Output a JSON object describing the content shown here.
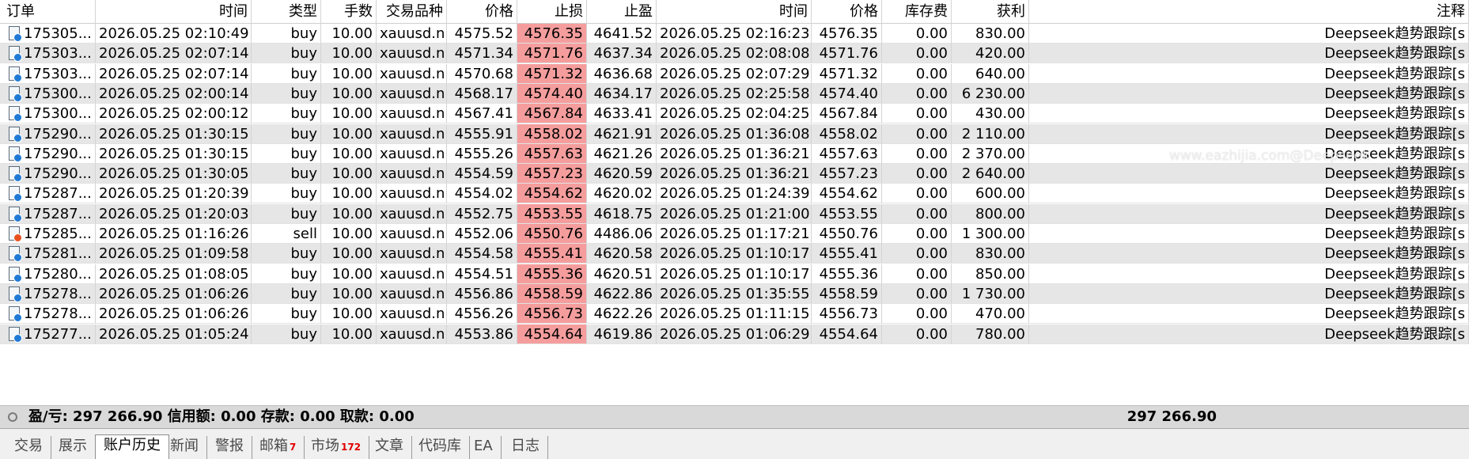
{
  "headers": [
    "订单",
    "时间",
    "类型",
    "手数",
    "交易品种",
    "价格",
    "止损",
    "止盈",
    "时间",
    "价格",
    "库存费",
    "获利",
    "注释"
  ],
  "rows": [
    {
      "order": "175305...",
      "open_time": "2026.05.25 02:10:49",
      "type": "buy",
      "lots": "10.00",
      "symbol": "xauusd.n",
      "open_price": "4575.52",
      "sl": "4576.35",
      "tp": "4641.52",
      "close_time": "2026.05.25 02:16:23",
      "close_price": "4576.35",
      "swap": "0.00",
      "profit": "830.00",
      "comment": "Deepseek趋势跟踪[s"
    },
    {
      "order": "175303...",
      "open_time": "2026.05.25 02:07:14",
      "type": "buy",
      "lots": "10.00",
      "symbol": "xauusd.n",
      "open_price": "4571.34",
      "sl": "4571.76",
      "tp": "4637.34",
      "close_time": "2026.05.25 02:08:08",
      "close_price": "4571.76",
      "swap": "0.00",
      "profit": "420.00",
      "comment": "Deepseek趋势跟踪[s"
    },
    {
      "order": "175303...",
      "open_time": "2026.05.25 02:07:14",
      "type": "buy",
      "lots": "10.00",
      "symbol": "xauusd.n",
      "open_price": "4570.68",
      "sl": "4571.32",
      "tp": "4636.68",
      "close_time": "2026.05.25 02:07:29",
      "close_price": "4571.32",
      "swap": "0.00",
      "profit": "640.00",
      "comment": "Deepseek趋势跟踪[s"
    },
    {
      "order": "175300...",
      "open_time": "2026.05.25 02:00:14",
      "type": "buy",
      "lots": "10.00",
      "symbol": "xauusd.n",
      "open_price": "4568.17",
      "sl": "4574.40",
      "tp": "4634.17",
      "close_time": "2026.05.25 02:25:58",
      "close_price": "4574.40",
      "swap": "0.00",
      "profit": "6 230.00",
      "comment": "Deepseek趋势跟踪[s"
    },
    {
      "order": "175300...",
      "open_time": "2026.05.25 02:00:12",
      "type": "buy",
      "lots": "10.00",
      "symbol": "xauusd.n",
      "open_price": "4567.41",
      "sl": "4567.84",
      "tp": "4633.41",
      "close_time": "2026.05.25 02:04:25",
      "close_price": "4567.84",
      "swap": "0.00",
      "profit": "430.00",
      "comment": "Deepseek趋势跟踪[s"
    },
    {
      "order": "175290...",
      "open_time": "2026.05.25 01:30:15",
      "type": "buy",
      "lots": "10.00",
      "symbol": "xauusd.n",
      "open_price": "4555.91",
      "sl": "4558.02",
      "tp": "4621.91",
      "close_time": "2026.05.25 01:36:08",
      "close_price": "4558.02",
      "swap": "0.00",
      "profit": "2 110.00",
      "comment": "Deepseek趋势跟踪[s"
    },
    {
      "order": "175290...",
      "open_time": "2026.05.25 01:30:15",
      "type": "buy",
      "lots": "10.00",
      "symbol": "xauusd.n",
      "open_price": "4555.26",
      "sl": "4557.63",
      "tp": "4621.26",
      "close_time": "2026.05.25 01:36:21",
      "close_price": "4557.63",
      "swap": "0.00",
      "profit": "2 370.00",
      "comment": "Deepseek趋势跟踪[s"
    },
    {
      "order": "175290...",
      "open_time": "2026.05.25 01:30:05",
      "type": "buy",
      "lots": "10.00",
      "symbol": "xauusd.n",
      "open_price": "4554.59",
      "sl": "4557.23",
      "tp": "4620.59",
      "close_time": "2026.05.25 01:36:21",
      "close_price": "4557.23",
      "swap": "0.00",
      "profit": "2 640.00",
      "comment": "Deepseek趋势跟踪[s"
    },
    {
      "order": "175287...",
      "open_time": "2026.05.25 01:20:39",
      "type": "buy",
      "lots": "10.00",
      "symbol": "xauusd.n",
      "open_price": "4554.02",
      "sl": "4554.62",
      "tp": "4620.02",
      "close_time": "2026.05.25 01:24:39",
      "close_price": "4554.62",
      "swap": "0.00",
      "profit": "600.00",
      "comment": "Deepseek趋势跟踪[s"
    },
    {
      "order": "175287...",
      "open_time": "2026.05.25 01:20:03",
      "type": "buy",
      "lots": "10.00",
      "symbol": "xauusd.n",
      "open_price": "4552.75",
      "sl": "4553.55",
      "tp": "4618.75",
      "close_time": "2026.05.25 01:21:00",
      "close_price": "4553.55",
      "swap": "0.00",
      "profit": "800.00",
      "comment": "Deepseek趋势跟踪[s"
    },
    {
      "order": "175285...",
      "open_time": "2026.05.25 01:16:26",
      "type": "sell",
      "lots": "10.00",
      "symbol": "xauusd.n",
      "open_price": "4552.06",
      "sl": "4550.76",
      "tp": "4486.06",
      "close_time": "2026.05.25 01:17:21",
      "close_price": "4550.76",
      "swap": "0.00",
      "profit": "1 300.00",
      "comment": "Deepseek趋势跟踪[s"
    },
    {
      "order": "175281...",
      "open_time": "2026.05.25 01:09:58",
      "type": "buy",
      "lots": "10.00",
      "symbol": "xauusd.n",
      "open_price": "4554.58",
      "sl": "4555.41",
      "tp": "4620.58",
      "close_time": "2026.05.25 01:10:17",
      "close_price": "4555.41",
      "swap": "0.00",
      "profit": "830.00",
      "comment": "Deepseek趋势跟踪[s"
    },
    {
      "order": "175280...",
      "open_time": "2026.05.25 01:08:05",
      "type": "buy",
      "lots": "10.00",
      "symbol": "xauusd.n",
      "open_price": "4554.51",
      "sl": "4555.36",
      "tp": "4620.51",
      "close_time": "2026.05.25 01:10:17",
      "close_price": "4555.36",
      "swap": "0.00",
      "profit": "850.00",
      "comment": "Deepseek趋势跟踪[s"
    },
    {
      "order": "175278...",
      "open_time": "2026.05.25 01:06:26",
      "type": "buy",
      "lots": "10.00",
      "symbol": "xauusd.n",
      "open_price": "4556.86",
      "sl": "4558.59",
      "tp": "4622.86",
      "close_time": "2026.05.25 01:35:55",
      "close_price": "4558.59",
      "swap": "0.00",
      "profit": "1 730.00",
      "comment": "Deepseek趋势跟踪[s"
    },
    {
      "order": "175278...",
      "open_time": "2026.05.25 01:06:26",
      "type": "buy",
      "lots": "10.00",
      "symbol": "xauusd.n",
      "open_price": "4556.26",
      "sl": "4556.73",
      "tp": "4622.26",
      "close_time": "2026.05.25 01:11:15",
      "close_price": "4556.73",
      "swap": "0.00",
      "profit": "470.00",
      "comment": "Deepseek趋势跟踪[s"
    },
    {
      "order": "175277...",
      "open_time": "2026.05.25 01:05:24",
      "type": "buy",
      "lots": "10.00",
      "symbol": "xauusd.n",
      "open_price": "4553.86",
      "sl": "4554.64",
      "tp": "4619.86",
      "close_time": "2026.05.25 01:06:29",
      "close_price": "4554.64",
      "swap": "0.00",
      "profit": "780.00",
      "comment": "Deepseek趋势跟踪[s"
    }
  ],
  "summary": {
    "text": "盈/亏: 297 266.90  信用额: 0.00  存款: 0.00  取款: 0.00",
    "total": "297 266.90"
  },
  "tabs": [
    {
      "label": "交易"
    },
    {
      "label": "展示"
    },
    {
      "label": "账户历史",
      "active": true
    },
    {
      "label": "新闻"
    },
    {
      "label": "警报"
    },
    {
      "label": "邮箱",
      "badge": "7"
    },
    {
      "label": "市场",
      "badge": "172"
    },
    {
      "label": "文章"
    },
    {
      "label": "代码库"
    },
    {
      "label": "EA"
    },
    {
      "label": "日志"
    }
  ],
  "watermark": "www.eazhijia.com@Deepseek",
  "colors": {
    "buy_icon": "#1f7ad6",
    "sell_icon": "#e8501e",
    "stop_loss_bg": "#f59d9d",
    "stripe": "#e6e6e6",
    "badge": "#e00000"
  }
}
